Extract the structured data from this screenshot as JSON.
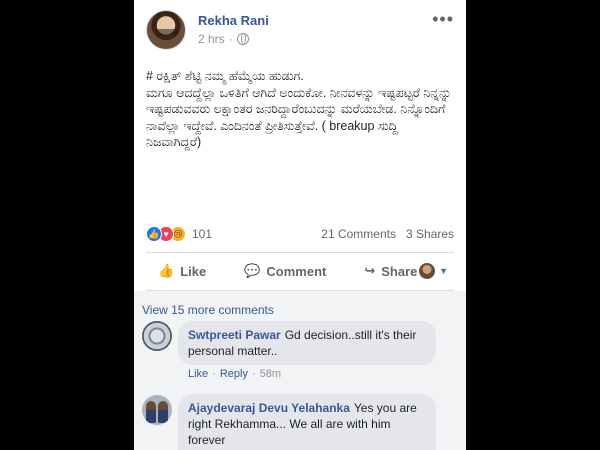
{
  "post": {
    "author": "Rekha Rani",
    "time": "2 hrs",
    "separator": "·",
    "more_glyph": "•••",
    "text": "# ರಕ್ಷಿತ್ ಶೆಟ್ಟಿ ನಮ್ಮ ಹೆಮ್ಮೆಯ ಹುಡುಗ.\nಮಗೂ ಆದದ್ದೆಲ್ಲಾ ಒಳಿತಿಗೆ ಆಗಿದೆ ಅಂದುಕೋ. ನೀನವಳನ್ನು ಇಷ್ಟಪಟ್ಟರೆ ನಿನ್ನನ್ನು ಇಷ್ಟಪಡುವವರು ಲಕ್ಷಾಂತರ ಜನರಿದ್ದಾರೆಂಬುದನ್ನು ಮರೆಯಬೇಡ. ನಿನ್ನೊಂದಿಗೆ ನಾವೆಲ್ಲಾ ಇದ್ದೇವೆ. ಎಂದಿನಂತೆ ಪ್ರೀತಿಸುತ್ತೇವೆ. ( breakup ಸುದ್ದಿ ನಿಜವಾಗಿದ್ದರೆ)"
  },
  "reactions": {
    "like_glyph": "👍",
    "love_glyph": "♥",
    "sad_glyph": "😢",
    "count": "101",
    "comments": "21 Comments",
    "shares": "3 Shares"
  },
  "actions": {
    "like_glyph": "👍",
    "like": "Like",
    "comment_glyph": "💬",
    "comment": "Comment",
    "share_glyph": "↪",
    "share": "Share",
    "caret_glyph": "▼"
  },
  "comments": {
    "view_more": "View 15 more comments",
    "items": [
      {
        "author": "Swtpreeti Pawar",
        "text": "Gd decision..still it's their personal matter..",
        "like": "Like",
        "reply": "Reply",
        "sep": "·",
        "time": "58m"
      },
      {
        "author": "Ajaydevaraj Devu Yelahanka",
        "text": "Yes you are right Rekhamma... We all are with him forever"
      }
    ]
  },
  "colors": {
    "link": "#385898",
    "text": "#1d2129",
    "muted": "#606770",
    "like_blue": "#1877f2",
    "love_red": "#f33e58",
    "sad_yellow": "#f7b125"
  }
}
